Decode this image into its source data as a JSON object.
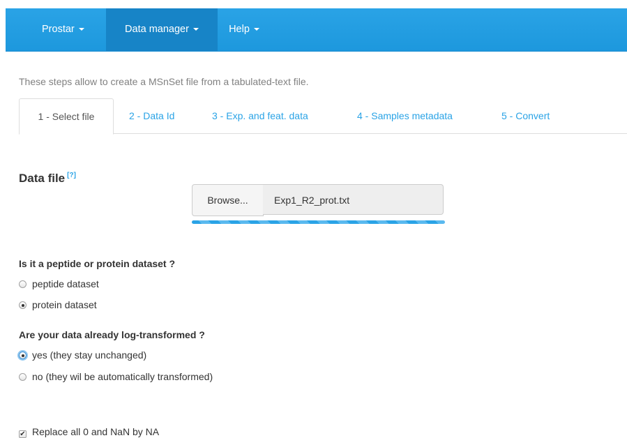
{
  "navbar": {
    "items": [
      {
        "label": "Prostar",
        "active": false
      },
      {
        "label": "Data manager",
        "active": true
      },
      {
        "label": "Help",
        "active": false
      }
    ],
    "color": "#2aa3e6"
  },
  "intro": "These steps allow to create a MSnSet file from a tabulated-text file.",
  "tabs": [
    {
      "label": "1 - Select file",
      "active": true
    },
    {
      "label": "2 - Data Id",
      "active": false
    },
    {
      "label": "3 - Exp. and feat. data",
      "active": false
    },
    {
      "label": "4 - Samples metadata",
      "active": false
    },
    {
      "label": "5 - Convert",
      "active": false
    }
  ],
  "data_file": {
    "title": "Data file",
    "help": "[?]",
    "browse_label": "Browse...",
    "file_name": "Exp1_R2_prot.txt",
    "upload_progress": 1.0
  },
  "dataset_type": {
    "question": "Is it a peptide or protein dataset ?",
    "options": [
      {
        "label": "peptide dataset",
        "checked": false
      },
      {
        "label": "protein dataset",
        "checked": true
      }
    ]
  },
  "log_transform": {
    "question": "Are your data already log-transformed ?",
    "options": [
      {
        "label": "yes (they stay unchanged)",
        "checked": true
      },
      {
        "label": "no (they wil be automatically transformed)",
        "checked": false
      }
    ]
  },
  "replace_zeros": {
    "label": "Replace all 0 and NaN by NA",
    "checked": true
  }
}
